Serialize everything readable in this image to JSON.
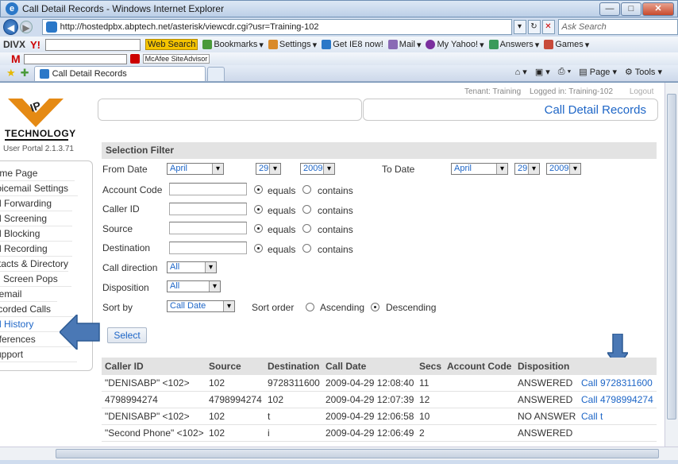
{
  "window": {
    "title": "Call Detail Records - Windows Internet Explorer",
    "buttons": [
      "—",
      "□",
      "✕"
    ]
  },
  "address": {
    "url": "http://hostedpbx.abptech.net/asterisk/viewcdr.cgi?usr=Training-102",
    "search_placeholder": "Ask Search"
  },
  "toolbar": {
    "divx": "DIVX",
    "yahoo": "Y!",
    "web_search": "Web Search",
    "items": [
      "Bookmarks",
      "Settings",
      "Get IE8 now!",
      "Mail",
      "My Yahoo!",
      "Answers",
      "Games"
    ]
  },
  "mcafee": {
    "label": "McAfee SiteAdvisor"
  },
  "tab": {
    "label": "Call Detail Records"
  },
  "commands": {
    "page": "Page",
    "tools": "Tools"
  },
  "header": {
    "tenant": "Tenant: Training",
    "logged_in": "Logged in: Training-102",
    "logout": "Logout",
    "page_title": "Call Detail Records"
  },
  "logo": {
    "ip": "IP",
    "tech": "TECHNOLOGY",
    "portal": "User Portal 2.1.3.71"
  },
  "sidebar": {
    "items": [
      "Home Page",
      "Voicemail Settings",
      "Call Forwarding",
      "Call Screening",
      "Call Blocking",
      "Call Recording",
      "Contacts & Directory",
      "Call Screen Pops",
      "Fax to email",
      "Recorded Calls",
      "Call History",
      "Preferences",
      "Support"
    ]
  },
  "filter": {
    "heading": "Selection Filter",
    "from_label": "From Date",
    "to_label": "To Date",
    "from_month": "April",
    "from_day": "29",
    "from_year": "2009",
    "to_month": "April",
    "to_day": "29",
    "to_year": "2009",
    "fields": [
      "Account Code",
      "Caller ID",
      "Source",
      "Destination"
    ],
    "equals": "equals",
    "contains": "contains",
    "direction_label": "Call direction",
    "direction_value": "All",
    "disposition_label": "Disposition",
    "disposition_value": "All",
    "sort_label": "Sort by",
    "sort_value": "Call Date",
    "order_label": "Sort order",
    "ascending": "Ascending",
    "descending": "Descending",
    "select_button": "Select"
  },
  "results": {
    "columns": [
      "Caller ID",
      "Source",
      "Destination",
      "Call Date",
      "Secs",
      "Account Code",
      "Disposition"
    ],
    "rows": [
      {
        "caller": "\"DENISABP\" <102>",
        "source": "102",
        "dest": "9728311600",
        "date": "2009-04-29 12:08:40",
        "secs": "11",
        "account": "",
        "disposition": "ANSWERED",
        "action": "Call 9728311600"
      },
      {
        "caller": "4798994274",
        "source": "4798994274",
        "dest": "102",
        "date": "2009-04-29 12:07:39",
        "secs": "12",
        "account": "",
        "disposition": "ANSWERED",
        "action": "Call 4798994274"
      },
      {
        "caller": "\"DENISABP\" <102>",
        "source": "102",
        "dest": "t",
        "date": "2009-04-29 12:06:58",
        "secs": "10",
        "account": "",
        "disposition": "NO ANSWER",
        "action": "Call t"
      },
      {
        "caller": "\"Second Phone\" <102>",
        "source": "102",
        "dest": "i",
        "date": "2009-04-29 12:06:49",
        "secs": "2",
        "account": "",
        "disposition": "ANSWERED",
        "action": ""
      }
    ]
  },
  "colors": {
    "accent": "#1e66c7",
    "arrow": "#4a78b5",
    "logo_orange": "#e58a14"
  }
}
